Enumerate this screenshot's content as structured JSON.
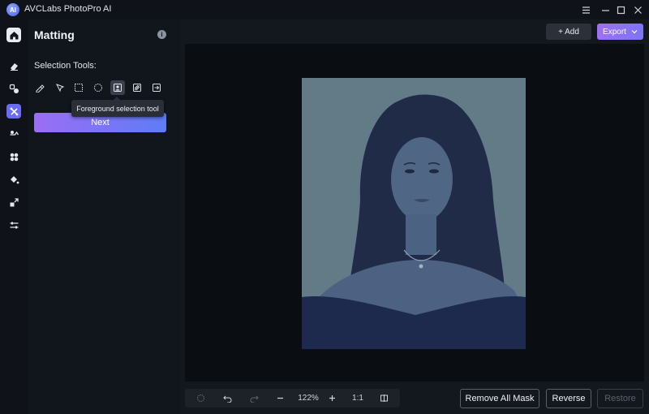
{
  "app": {
    "title": "AVCLabs PhotoPro AI",
    "logo_text": "AI"
  },
  "window_controls": [
    "menu-icon",
    "minimize-icon",
    "maximize-icon",
    "close-icon"
  ],
  "rail": [
    "home-icon",
    "eraser-icon",
    "object-replace-icon",
    "matting-icon",
    "enhance-icon",
    "colorize-icon",
    "fill-icon",
    "upscale-icon",
    "adjust-icon"
  ],
  "panel": {
    "title": "Matting",
    "section_label": "Selection Tools:",
    "tools": [
      "brush-tool-icon",
      "lasso-tool-icon",
      "rectangle-tool-icon",
      "ellipse-tool-icon",
      "foreground-selection-icon",
      "background-selection-icon",
      "import-mask-icon"
    ],
    "tooltip": "Foreground selection tool",
    "next_label": "Next"
  },
  "toolbar": {
    "add_label": "+ Add",
    "export_label": "Export"
  },
  "zoom": {
    "level": "122%",
    "ratio": "1:1"
  },
  "actions": {
    "remove_all_mask": "Remove All Mask",
    "reverse": "Reverse",
    "restore": "Restore"
  },
  "colors": {
    "accent_start": "#9b6ef5",
    "accent_end": "#5e7cf6",
    "mask_overlay": "#637b87"
  }
}
